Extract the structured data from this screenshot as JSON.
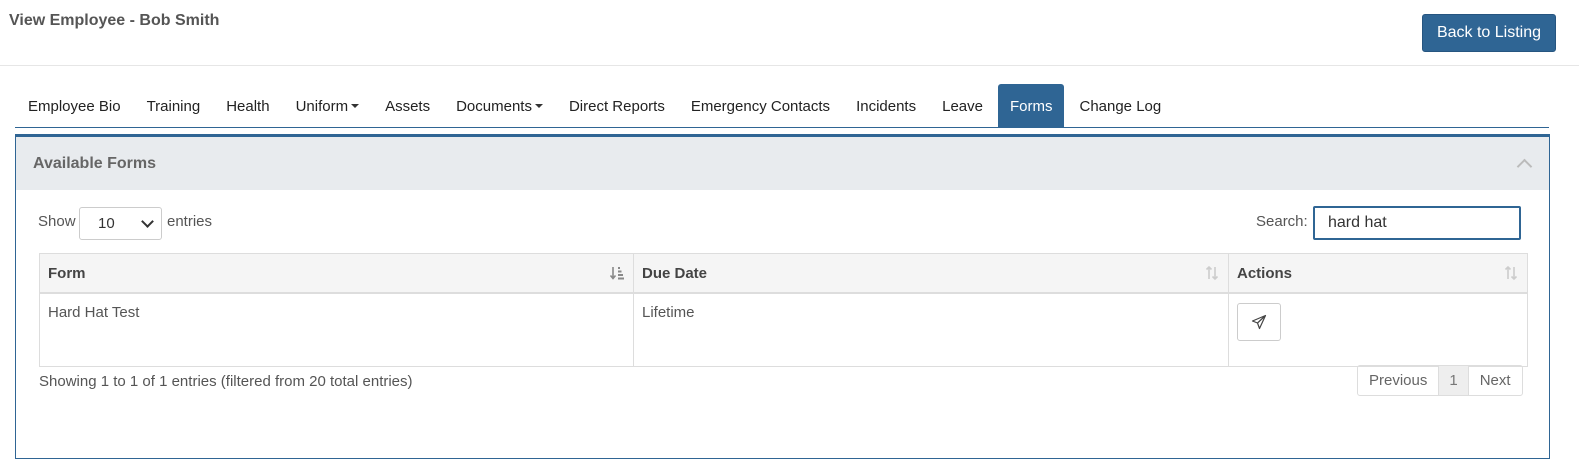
{
  "header": {
    "title": "View Employee - Bob Smith",
    "back_label": "Back to Listing"
  },
  "tabs": [
    {
      "label": "Employee Bio"
    },
    {
      "label": "Training"
    },
    {
      "label": "Health"
    },
    {
      "label": "Uniform",
      "dropdown": true
    },
    {
      "label": "Assets"
    },
    {
      "label": "Documents",
      "dropdown": true
    },
    {
      "label": "Direct Reports"
    },
    {
      "label": "Emergency Contacts"
    },
    {
      "label": "Incidents"
    },
    {
      "label": "Leave"
    },
    {
      "label": "Forms",
      "active": true
    },
    {
      "label": "Change Log"
    }
  ],
  "panel": {
    "title": "Available Forms"
  },
  "controls": {
    "show_label": "Show",
    "entries_value": "10",
    "entries_label": "entries",
    "search_label": "Search:",
    "search_value": "hard hat"
  },
  "table": {
    "columns": [
      "Form",
      "Due Date",
      "Actions"
    ],
    "rows": [
      {
        "form": "Hard Hat Test",
        "due_date": "Lifetime",
        "action_icon": "send-icon"
      }
    ]
  },
  "footer": {
    "info": "Showing 1 to 1 of 1 entries (filtered from 20 total entries)",
    "prev_label": "Previous",
    "page": "1",
    "next_label": "Next"
  },
  "colors": {
    "accent": "#2f6594",
    "panel_header_bg": "#e8ebee"
  }
}
